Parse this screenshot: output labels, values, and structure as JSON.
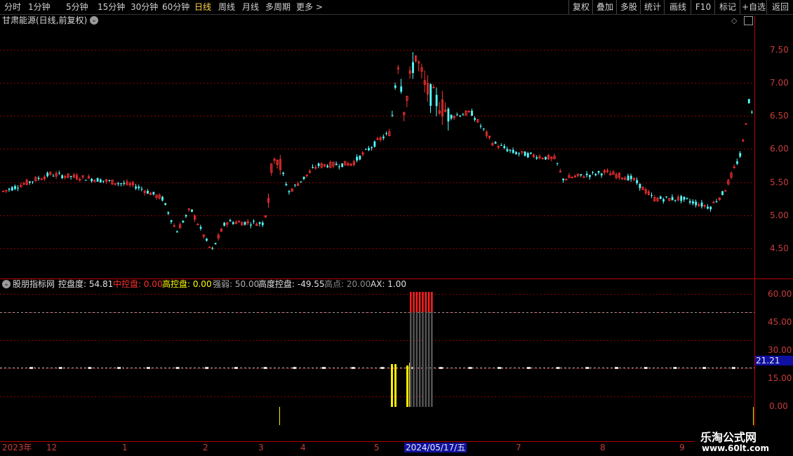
{
  "toolbar": {
    "periods": [
      "分时",
      "1分钟",
      "5分钟",
      "15分钟",
      "30分钟",
      "60分钟",
      "日线",
      "周线",
      "月线",
      "多周期",
      "更多 >"
    ],
    "active_period": "日线",
    "right_buttons": [
      "复权",
      "叠加",
      "多股",
      "统计",
      "画线",
      "F10",
      "标记",
      "+自选",
      "返回"
    ]
  },
  "main_panel": {
    "title": "甘肃能源(日线,前复权)",
    "price_axis": [
      "7.50",
      "7.00",
      "6.50",
      "6.00",
      "5.50",
      "5.00",
      "4.50"
    ]
  },
  "indicator": {
    "name": "股朋指标网",
    "items": [
      {
        "label": "控盘度: 54.81",
        "color": "#e0e0e0"
      },
      {
        "label": "中控盘: 0.00",
        "color": "#ff3030"
      },
      {
        "label": "高控盘: 0.00",
        "color": "#ffff00"
      },
      {
        "label": "强弱: 50.00",
        "color": "#b0b0b0"
      },
      {
        "label": "高度控盘: -49.55",
        "color": "#e0e0e0"
      },
      {
        "label": "高点: 20.00",
        "color": "#8a8a8a"
      },
      {
        "label": "AX: 1.00",
        "color": "#e0e0e0"
      }
    ],
    "axis": [
      "60.00",
      "45.00",
      "30.00",
      "15.00",
      "0.00"
    ],
    "current_value": "21.21"
  },
  "date_axis": {
    "labels": [
      "2023年",
      "12",
      "1",
      "2",
      "3",
      "4",
      "5",
      "2024/05/17/五",
      "7",
      "8",
      "9"
    ]
  },
  "watermark": {
    "line1": "乐淘公式网",
    "line2": "www.60lt.com"
  },
  "colors": {
    "up": "#ff3232",
    "down": "#54ffff",
    "grid": "#8b0000",
    "axis_text": "#c83c3c",
    "gold": "#ffd24a"
  }
}
